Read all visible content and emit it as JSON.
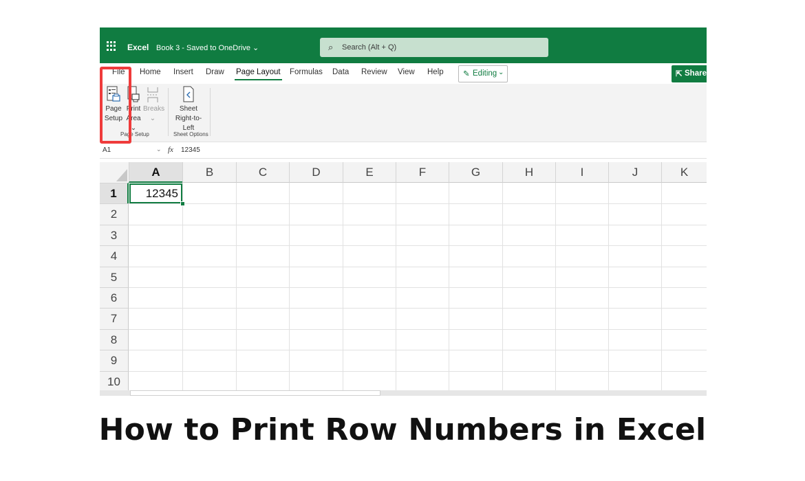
{
  "titlebar": {
    "app_name": "Excel",
    "doc_title": "Book 3 - Saved to OneDrive ⌄",
    "search_placeholder": "Search (Alt + Q)"
  },
  "ribbon_tabs": [
    "File",
    "Home",
    "Insert",
    "Draw",
    "Page Layout",
    "Formulas",
    "Data",
    "Review",
    "View",
    "Help"
  ],
  "active_tab": "Page Layout",
  "editing_label": "Editing",
  "share_label": "Share",
  "ribbon": {
    "page_setup": {
      "commands": [
        {
          "line1": "Page",
          "line2": "Setup",
          "icon": "page-setup-icon"
        },
        {
          "line1": "Print",
          "line2": "Area ⌄",
          "icon": "print-area-icon"
        },
        {
          "line1": "Breaks",
          "line2": "⌄",
          "icon": "breaks-icon",
          "disabled": true
        }
      ],
      "group_label": "Page Setup"
    },
    "sheet_options": {
      "commands": [
        {
          "line1": "Sheet",
          "line2": "Right-to-Left",
          "icon": "sheet-rtl-icon"
        }
      ],
      "group_label": "Sheet Options"
    }
  },
  "formula_bar": {
    "name_box": "A1",
    "fx": "fx",
    "value": "12345"
  },
  "grid": {
    "columns": [
      "A",
      "B",
      "C",
      "D",
      "E",
      "F",
      "G",
      "H",
      "I",
      "J",
      "K"
    ],
    "rows": [
      "1",
      "2",
      "3",
      "4",
      "5",
      "6",
      "7",
      "8",
      "9",
      "10"
    ],
    "selected_cell": "A1",
    "cells": {
      "A1": "12345"
    }
  },
  "caption": "How to Print Row Numbers in Excel",
  "colors": {
    "accent": "#107c41",
    "highlight": "#ef3b3b"
  }
}
